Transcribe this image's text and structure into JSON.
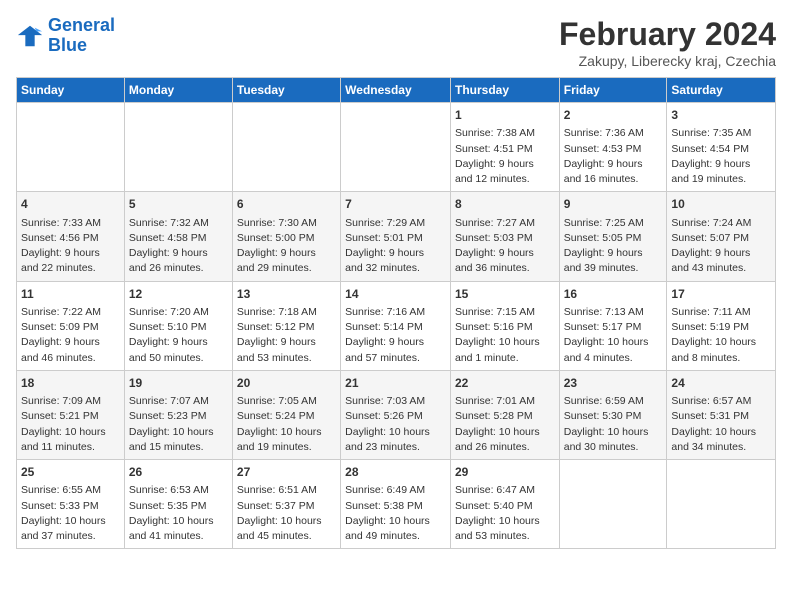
{
  "logo": {
    "line1": "General",
    "line2": "Blue"
  },
  "title": "February 2024",
  "subtitle": "Zakupy, Liberecky kraj, Czechia",
  "days_header": [
    "Sunday",
    "Monday",
    "Tuesday",
    "Wednesday",
    "Thursday",
    "Friday",
    "Saturday"
  ],
  "weeks": [
    [
      {
        "num": "",
        "content": ""
      },
      {
        "num": "",
        "content": ""
      },
      {
        "num": "",
        "content": ""
      },
      {
        "num": "",
        "content": ""
      },
      {
        "num": "1",
        "content": "Sunrise: 7:38 AM\nSunset: 4:51 PM\nDaylight: 9 hours\nand 12 minutes."
      },
      {
        "num": "2",
        "content": "Sunrise: 7:36 AM\nSunset: 4:53 PM\nDaylight: 9 hours\nand 16 minutes."
      },
      {
        "num": "3",
        "content": "Sunrise: 7:35 AM\nSunset: 4:54 PM\nDaylight: 9 hours\nand 19 minutes."
      }
    ],
    [
      {
        "num": "4",
        "content": "Sunrise: 7:33 AM\nSunset: 4:56 PM\nDaylight: 9 hours\nand 22 minutes."
      },
      {
        "num": "5",
        "content": "Sunrise: 7:32 AM\nSunset: 4:58 PM\nDaylight: 9 hours\nand 26 minutes."
      },
      {
        "num": "6",
        "content": "Sunrise: 7:30 AM\nSunset: 5:00 PM\nDaylight: 9 hours\nand 29 minutes."
      },
      {
        "num": "7",
        "content": "Sunrise: 7:29 AM\nSunset: 5:01 PM\nDaylight: 9 hours\nand 32 minutes."
      },
      {
        "num": "8",
        "content": "Sunrise: 7:27 AM\nSunset: 5:03 PM\nDaylight: 9 hours\nand 36 minutes."
      },
      {
        "num": "9",
        "content": "Sunrise: 7:25 AM\nSunset: 5:05 PM\nDaylight: 9 hours\nand 39 minutes."
      },
      {
        "num": "10",
        "content": "Sunrise: 7:24 AM\nSunset: 5:07 PM\nDaylight: 9 hours\nand 43 minutes."
      }
    ],
    [
      {
        "num": "11",
        "content": "Sunrise: 7:22 AM\nSunset: 5:09 PM\nDaylight: 9 hours\nand 46 minutes."
      },
      {
        "num": "12",
        "content": "Sunrise: 7:20 AM\nSunset: 5:10 PM\nDaylight: 9 hours\nand 50 minutes."
      },
      {
        "num": "13",
        "content": "Sunrise: 7:18 AM\nSunset: 5:12 PM\nDaylight: 9 hours\nand 53 minutes."
      },
      {
        "num": "14",
        "content": "Sunrise: 7:16 AM\nSunset: 5:14 PM\nDaylight: 9 hours\nand 57 minutes."
      },
      {
        "num": "15",
        "content": "Sunrise: 7:15 AM\nSunset: 5:16 PM\nDaylight: 10 hours\nand 1 minute."
      },
      {
        "num": "16",
        "content": "Sunrise: 7:13 AM\nSunset: 5:17 PM\nDaylight: 10 hours\nand 4 minutes."
      },
      {
        "num": "17",
        "content": "Sunrise: 7:11 AM\nSunset: 5:19 PM\nDaylight: 10 hours\nand 8 minutes."
      }
    ],
    [
      {
        "num": "18",
        "content": "Sunrise: 7:09 AM\nSunset: 5:21 PM\nDaylight: 10 hours\nand 11 minutes."
      },
      {
        "num": "19",
        "content": "Sunrise: 7:07 AM\nSunset: 5:23 PM\nDaylight: 10 hours\nand 15 minutes."
      },
      {
        "num": "20",
        "content": "Sunrise: 7:05 AM\nSunset: 5:24 PM\nDaylight: 10 hours\nand 19 minutes."
      },
      {
        "num": "21",
        "content": "Sunrise: 7:03 AM\nSunset: 5:26 PM\nDaylight: 10 hours\nand 23 minutes."
      },
      {
        "num": "22",
        "content": "Sunrise: 7:01 AM\nSunset: 5:28 PM\nDaylight: 10 hours\nand 26 minutes."
      },
      {
        "num": "23",
        "content": "Sunrise: 6:59 AM\nSunset: 5:30 PM\nDaylight: 10 hours\nand 30 minutes."
      },
      {
        "num": "24",
        "content": "Sunrise: 6:57 AM\nSunset: 5:31 PM\nDaylight: 10 hours\nand 34 minutes."
      }
    ],
    [
      {
        "num": "25",
        "content": "Sunrise: 6:55 AM\nSunset: 5:33 PM\nDaylight: 10 hours\nand 37 minutes."
      },
      {
        "num": "26",
        "content": "Sunrise: 6:53 AM\nSunset: 5:35 PM\nDaylight: 10 hours\nand 41 minutes."
      },
      {
        "num": "27",
        "content": "Sunrise: 6:51 AM\nSunset: 5:37 PM\nDaylight: 10 hours\nand 45 minutes."
      },
      {
        "num": "28",
        "content": "Sunrise: 6:49 AM\nSunset: 5:38 PM\nDaylight: 10 hours\nand 49 minutes."
      },
      {
        "num": "29",
        "content": "Sunrise: 6:47 AM\nSunset: 5:40 PM\nDaylight: 10 hours\nand 53 minutes."
      },
      {
        "num": "",
        "content": ""
      },
      {
        "num": "",
        "content": ""
      }
    ]
  ]
}
